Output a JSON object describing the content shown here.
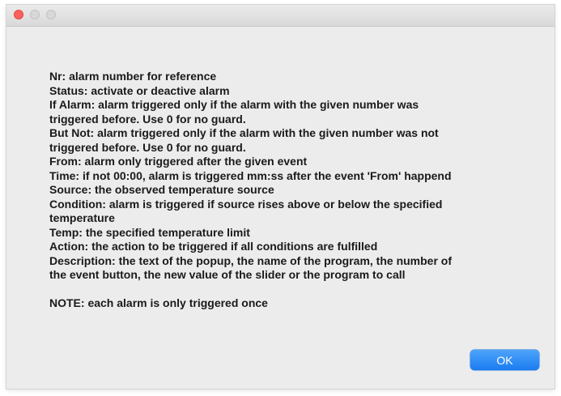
{
  "window": {
    "controls": {
      "close": "close-button",
      "minimize": "minimize-button",
      "zoom": "zoom-button"
    }
  },
  "message": {
    "lines": [
      "Nr: alarm number for reference",
      "Status: activate or deactive alarm",
      "If Alarm: alarm triggered only if the alarm with the given number was",
      "triggered before. Use 0 for no guard.",
      "But Not: alarm triggered only if the alarm with the given number was not",
      "triggered before. Use 0 for no guard.",
      "From: alarm only triggered after the given event",
      "Time: if not 00:00, alarm is triggered mm:ss after the event 'From' happend",
      "Source: the observed temperature source",
      "Condition: alarm is triggered if source rises above or below the specified",
      "temperature",
      "Temp: the specified temperature limit",
      "Action: the action to be triggered if all conditions are fulfilled",
      "Description: the text of the popup, the name of the program, the number of",
      "the event button, the new value of the slider or the program to call"
    ],
    "note": "NOTE: each alarm is only triggered once"
  },
  "buttons": {
    "ok_label": "OK"
  },
  "colors": {
    "accent": "#1b7cf0",
    "close": "#fc605c",
    "window_background": "#ececec"
  }
}
